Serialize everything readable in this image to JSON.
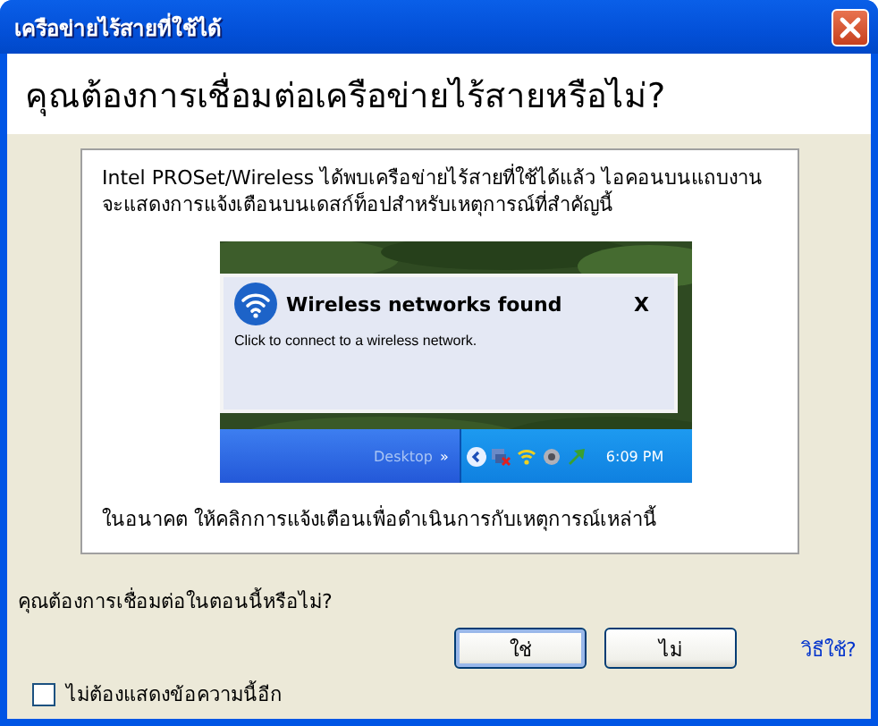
{
  "window": {
    "title": "เครือข่ายไร้สายที่ใช้ได้"
  },
  "heading": "คุณต้องการเชื่อมต่อเครือข่ายไร้สายหรือไม่?",
  "panel": {
    "intro": "Intel PROSet/Wireless ได้พบเครือข่ายไร้สายที่ใช้ได้แล้ว ไอคอนบนแถบงานจะแสดงการแจ้งเตือนบนเดสก์ท็อปสำหรับเหตุการณ์ที่สำคัญนี้",
    "screenshot": {
      "balloon": {
        "title": "Wireless networks found",
        "close": "X",
        "message": "Click to connect to a wireless network."
      },
      "taskbar": {
        "toolbar_label": "Desktop",
        "chevron": "»",
        "clock": "6:09 PM"
      }
    },
    "footer_note": "ในอนาคต ให้คลิกการแจ้งเตือนเพื่อดำเนินการกับเหตุการณ์เหล่านี้"
  },
  "question": "คุณต้องการเชื่อมต่อในตอนนี้หรือไม่?",
  "buttons": [
    {
      "label": "ใช่",
      "default": true
    },
    {
      "label": "ไม่",
      "default": false
    }
  ],
  "help_link": "วิธีใช้?",
  "dont_show": {
    "label": "ไม่ต้องแสดงข้อความนี้อีก",
    "checked": false
  }
}
